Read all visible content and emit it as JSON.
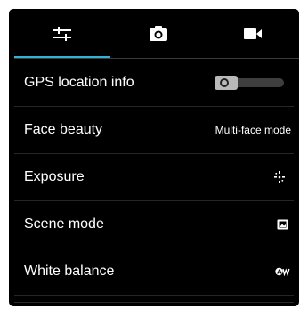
{
  "tabs": [
    {
      "icon": "settings-sliders-icon",
      "active": true
    },
    {
      "icon": "camera-icon",
      "active": false
    },
    {
      "icon": "video-camera-icon",
      "active": false
    }
  ],
  "settings": {
    "gps": {
      "label": "GPS location info",
      "enabled": false
    },
    "face_beauty": {
      "label": "Face beauty",
      "value": "Multi-face mode"
    },
    "exposure": {
      "label": "Exposure",
      "icon": "exposure-icon"
    },
    "scene_mode": {
      "label": "Scene mode",
      "icon": "scene-mode-icon"
    },
    "white_balance": {
      "label": "White balance",
      "icon": "auto-white-balance-icon"
    }
  },
  "colors": {
    "background": "#000000",
    "accent": "#2fb3d8",
    "text": "#ffffff",
    "toggle_track": "#3e3e3e",
    "toggle_thumb": "#b9b9b9"
  }
}
